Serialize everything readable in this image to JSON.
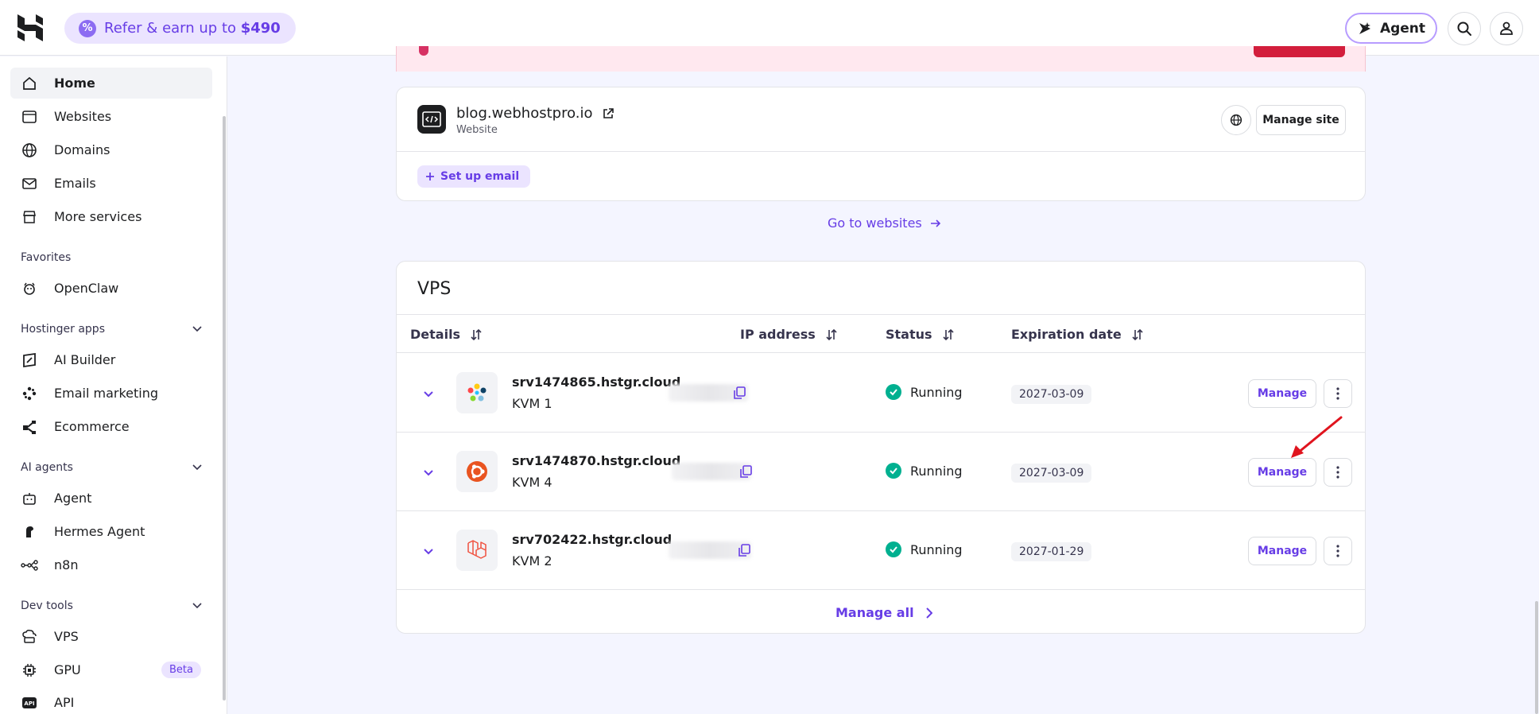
{
  "topbar": {
    "refer_text": "Refer & earn up to ",
    "refer_amount": "$490",
    "agent_label": "Agent",
    "icons": [
      "hostinger-logo",
      "percent-badge-icon",
      "agent-icon",
      "search-icon",
      "user-icon"
    ]
  },
  "sidebar": {
    "main_items": [
      {
        "label": "Home",
        "icon": "home-icon",
        "active": true
      },
      {
        "label": "Websites",
        "icon": "browser-icon"
      },
      {
        "label": "Domains",
        "icon": "globe-icon"
      },
      {
        "label": "Emails",
        "icon": "mail-icon"
      },
      {
        "label": "More services",
        "icon": "store-icon"
      }
    ],
    "favorites_title": "Favorites",
    "favorites": [
      {
        "label": "OpenClaw",
        "icon": "claw-icon"
      }
    ],
    "apps_title": "Hostinger apps",
    "apps": [
      {
        "label": "AI Builder",
        "icon": "ai-builder-icon"
      },
      {
        "label": "Email marketing",
        "icon": "email-marketing-icon"
      },
      {
        "label": "Ecommerce",
        "icon": "ecommerce-icon"
      }
    ],
    "agents_title": "AI agents",
    "agents": [
      {
        "label": "Agent",
        "icon": "bot-icon"
      },
      {
        "label": "Hermes Agent",
        "icon": "hermes-icon"
      },
      {
        "label": "n8n",
        "icon": "n8n-icon"
      }
    ],
    "dev_title": "Dev tools",
    "dev": [
      {
        "label": "VPS",
        "icon": "cloud-server-icon"
      },
      {
        "label": "GPU",
        "icon": "chip-icon",
        "badge": "Beta"
      },
      {
        "label": "API",
        "icon": "api-icon"
      }
    ]
  },
  "website_card": {
    "domain": "blog.webhostpro.io",
    "type": "Website",
    "manage_label": "Manage site",
    "setup_email_label": "Set up email"
  },
  "go_to_websites": "Go to websites",
  "vps": {
    "title": "VPS",
    "columns": [
      "Details",
      "IP address",
      "Status",
      "Expiration date"
    ],
    "rows": [
      {
        "hostname": "srv1474865.hstgr.cloud",
        "plan": "KVM 1",
        "os": "almalinux",
        "status": "Running",
        "expires": "2027-03-09",
        "manage": "Manage"
      },
      {
        "hostname": "srv1474870.hstgr.cloud",
        "plan": "KVM 4",
        "os": "ubuntu",
        "status": "Running",
        "expires": "2027-03-09",
        "manage": "Manage"
      },
      {
        "hostname": "srv702422.hstgr.cloud",
        "plan": "KVM 2",
        "os": "laravel",
        "status": "Running",
        "expires": "2027-01-29",
        "manage": "Manage"
      }
    ],
    "manage_all": "Manage all"
  },
  "colors": {
    "accent": "#673de6",
    "success": "#00b090",
    "danger": "#d31e3c"
  }
}
